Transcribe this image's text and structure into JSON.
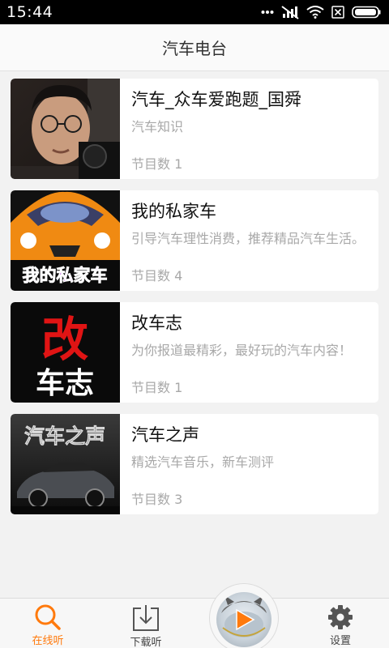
{
  "status_bar": {
    "time": "15:44"
  },
  "header": {
    "title": "汽车电台"
  },
  "items": [
    {
      "title": "汽车_众车爱跑题_国舜",
      "desc": "汽车知识",
      "count": "节目数 1"
    },
    {
      "title": "我的私家车",
      "desc": "引导汽车理性消费，推荐精品汽车生活。",
      "count": "节目数 4",
      "thumb_text": "我的私家车"
    },
    {
      "title": "改车志",
      "desc": "为你报道最精彩，最好玩的汽车内容！",
      "count": "节目数 1",
      "thumb_text_top": "改",
      "thumb_text_bottom": "车志"
    },
    {
      "title": "汽车之声",
      "desc": "精选汽车音乐，新车测评",
      "count": "节目数 3",
      "thumb_text": "汽车之声"
    }
  ],
  "tabbar": {
    "tabs": [
      {
        "label": "在线听",
        "icon": "search-icon",
        "active": true
      },
      {
        "label": "下载听",
        "icon": "download-icon",
        "active": false
      },
      {
        "label": "设置",
        "icon": "gear-icon",
        "active": false
      }
    ],
    "play_icon": "play-icon"
  },
  "colors": {
    "accent": "#ff7a0d",
    "status_bar": "#000000",
    "card_bg": "#ffffff",
    "page_bg": "#f2f2f2"
  }
}
